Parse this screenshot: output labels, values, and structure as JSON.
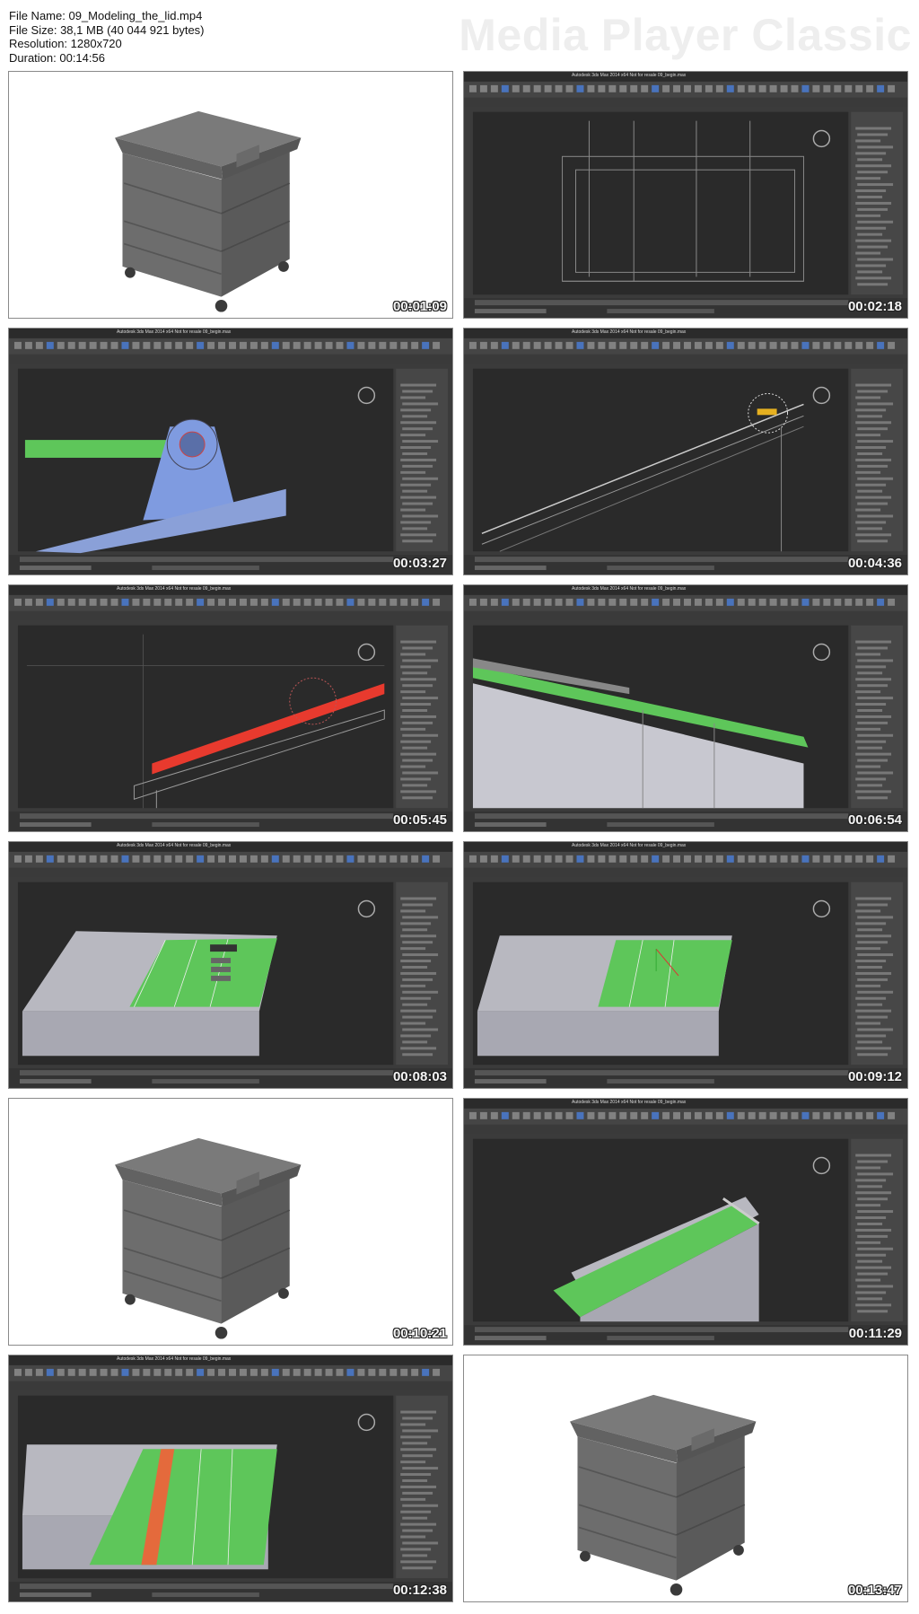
{
  "header": {
    "file_name": "File Name: 09_Modeling_the_lid.mp4",
    "file_size": "File Size: 38,1 MB (40 044 921 bytes)",
    "resolution": "Resolution: 1280x720",
    "duration": "Duration: 00:14:56",
    "brand": "Media Player Classic"
  },
  "app": {
    "title": "Autodesk 3ds Max 2014 x64   Not for resale   09_begin.max"
  },
  "thumbnails": [
    {
      "timestamp": "00:01:09",
      "kind": "render"
    },
    {
      "timestamp": "00:02:18",
      "kind": "max-wire"
    },
    {
      "timestamp": "00:03:27",
      "kind": "max-hinge"
    },
    {
      "timestamp": "00:04:36",
      "kind": "max-rod"
    },
    {
      "timestamp": "00:05:45",
      "kind": "max-red"
    },
    {
      "timestamp": "00:06:54",
      "kind": "max-lidside"
    },
    {
      "timestamp": "00:08:03",
      "kind": "max-lidtop"
    },
    {
      "timestamp": "00:09:12",
      "kind": "max-lidtop2"
    },
    {
      "timestamp": "00:10:21",
      "kind": "render"
    },
    {
      "timestamp": "00:11:29",
      "kind": "max-lidopen"
    },
    {
      "timestamp": "00:12:38",
      "kind": "max-lidstripe"
    },
    {
      "timestamp": "00:13:47",
      "kind": "render2"
    }
  ],
  "colors": {
    "ui_dark": "#3b3b3b",
    "viewport": "#2a2a2a",
    "panel": "#474747",
    "green": "#5ec65a",
    "red": "#e83a2e",
    "orange": "#e46a3c",
    "blue_sel": "#7f9be0"
  }
}
